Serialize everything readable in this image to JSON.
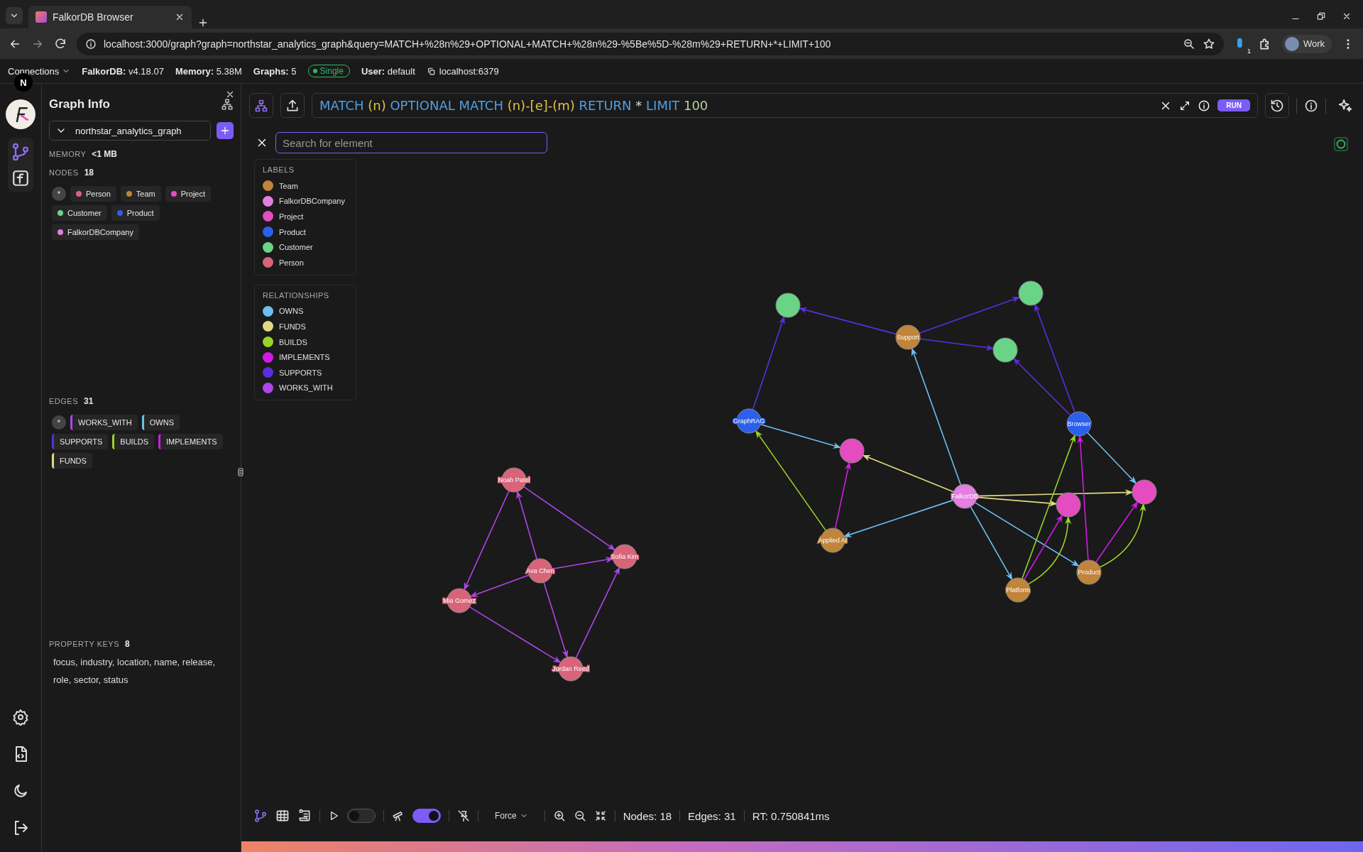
{
  "browser": {
    "tab": {
      "title": "FalkorDB Browser"
    },
    "url": "localhost:3000/graph?graph=northstar_analytics_graph&query=MATCH+%28n%29+OPTIONAL+MATCH+%28n%29-%5Be%5D-%28m%29+RETURN+*+LIMIT+100",
    "profile": "Work",
    "extension_badge": "1"
  },
  "header": {
    "connections": "Connections",
    "stats": [
      {
        "label": "FalkorDB:",
        "value": "v4.18.07"
      },
      {
        "label": "Memory:",
        "value": "5.38M"
      },
      {
        "label": "Graphs:",
        "value": "5"
      }
    ],
    "mode_badge": "Single",
    "user": {
      "label": "User:",
      "value": "default"
    },
    "host": "localhost:6379"
  },
  "rail": {
    "avatar": "N"
  },
  "sidebar": {
    "title": "Graph Info",
    "graph_select": "northstar_analytics_graph",
    "memory": {
      "label": "MEMORY",
      "value": "<1 MB"
    },
    "nodes": {
      "label": "NODES",
      "count": "18",
      "chips": [
        {
          "text": "*",
          "kind": "all"
        },
        {
          "text": "Person",
          "kind": "label",
          "color": "#d8647a"
        },
        {
          "text": "Team",
          "kind": "label",
          "color": "#c0843a"
        },
        {
          "text": "Project",
          "kind": "label",
          "color": "#e44cc0"
        },
        {
          "text": "Customer",
          "kind": "label",
          "color": "#6ad486"
        },
        {
          "text": "Product",
          "kind": "label",
          "color": "#2c5fec"
        },
        {
          "text": "FalkorDBCompany",
          "kind": "label",
          "color": "#e47ee0"
        }
      ]
    },
    "edges": {
      "label": "EDGES",
      "count": "31",
      "chips": [
        {
          "text": "*",
          "kind": "all"
        },
        {
          "text": "WORKS_WITH",
          "kind": "label",
          "color": "#b044e8"
        },
        {
          "text": "OWNS",
          "kind": "label",
          "color": "#6cc0f0"
        },
        {
          "text": "SUPPORTS",
          "kind": "label",
          "color": "#5a2ee0"
        },
        {
          "text": "BUILDS",
          "kind": "label",
          "color": "#98d428"
        },
        {
          "text": "IMPLEMENTS",
          "kind": "label",
          "color": "#d21ae8"
        },
        {
          "text": "FUNDS",
          "kind": "label",
          "color": "#e0d886"
        }
      ]
    },
    "property_keys": {
      "label": "PROPERTY KEYS",
      "count": "8",
      "text": "focus, industry, location, name, release, role, sector, status"
    }
  },
  "query": {
    "tokens": [
      {
        "text": "MATCH",
        "kind": "keyword"
      },
      {
        "text": "(n)",
        "kind": "pattern"
      },
      {
        "text": "OPTIONAL MATCH",
        "kind": "keyword"
      },
      {
        "text": "(n)-[e]-(m)",
        "kind": "pattern"
      },
      {
        "text": "RETURN",
        "kind": "keyword"
      },
      {
        "text": "*",
        "kind": "operator"
      },
      {
        "text": "LIMIT",
        "kind": "keyword"
      },
      {
        "text": "100",
        "kind": "number"
      }
    ],
    "run": "RUN"
  },
  "search": {
    "placeholder": "Search for element"
  },
  "legend": {
    "labels": {
      "title": "LABELS",
      "items": [
        {
          "name": "Team",
          "color": "#c0843a"
        },
        {
          "name": "FalkorDBCompany",
          "color": "#e47ee0"
        },
        {
          "name": "Project",
          "color": "#e44cc0"
        },
        {
          "name": "Product",
          "color": "#2c5fec"
        },
        {
          "name": "Customer",
          "color": "#6ad486"
        },
        {
          "name": "Person",
          "color": "#d8647a"
        }
      ]
    },
    "relationships": {
      "title": "RELATIONSHIPS",
      "items": [
        {
          "name": "OWNS",
          "color": "#6cc0f0"
        },
        {
          "name": "FUNDS",
          "color": "#e0d886"
        },
        {
          "name": "BUILDS",
          "color": "#98d428"
        },
        {
          "name": "IMPLEMENTS",
          "color": "#d21ae8"
        },
        {
          "name": "SUPPORTS",
          "color": "#5a2ee0"
        },
        {
          "name": "WORKS_WITH",
          "color": "#b044e8"
        }
      ]
    }
  },
  "graph": {
    "nodes": [
      {
        "color": "#6ad486"
      },
      {
        "color": "#6ad486"
      },
      {
        "name": "Support",
        "color": "#c0843a"
      },
      {
        "color": "#6ad486"
      },
      {
        "name": "GraphRAG",
        "color": "#2c5fec"
      },
      {
        "name": "Browser",
        "color": "#2c5fec"
      },
      {
        "color": "#e44cc0"
      },
      {
        "name": "FalkorDB",
        "color": "#e47ee0"
      },
      {
        "color": "#e44cc0"
      },
      {
        "color": "#e44cc0"
      },
      {
        "name": "Applied AI",
        "color": "#c0843a"
      },
      {
        "name": "Platform",
        "color": "#c0843a"
      },
      {
        "name": "Product",
        "color": "#c0843a"
      },
      {
        "name": "Noah Patel",
        "color": "#d8647a"
      },
      {
        "name": "Sofia Kim",
        "color": "#d8647a"
      },
      {
        "name": "Ava Chen",
        "color": "#d8647a"
      },
      {
        "name": "Mia Gomez",
        "color": "#d8647a"
      },
      {
        "name": "Jordan Reed",
        "color": "#d8647a"
      }
    ],
    "edges": [
      {
        "color": "#5a2ee0"
      },
      {
        "color": "#5a2ee0"
      },
      {
        "color": "#5a2ee0"
      },
      {
        "color": "#5a2ee0"
      },
      {
        "color": "#5a2ee0"
      },
      {
        "color": "#5a2ee0"
      },
      {
        "color": "#6cc0f0"
      },
      {
        "color": "#6cc0f0"
      },
      {
        "color": "#6cc0f0"
      },
      {
        "color": "#6cc0f0"
      },
      {
        "color": "#6cc0f0"
      },
      {
        "color": "#6cc0f0"
      },
      {
        "color": "#e0d886"
      },
      {
        "color": "#e0d886"
      },
      {
        "color": "#e0d886"
      },
      {
        "color": "#98d428"
      },
      {
        "color": "#98d428"
      },
      {
        "color": "#98d428"
      },
      {
        "color": "#98d428"
      },
      {
        "color": "#d21ae8"
      },
      {
        "color": "#d21ae8"
      },
      {
        "color": "#d21ae8"
      },
      {
        "color": "#d21ae8"
      },
      {
        "color": "#b044e8"
      },
      {
        "color": "#b044e8"
      },
      {
        "color": "#b044e8"
      },
      {
        "color": "#b044e8"
      },
      {
        "color": "#b044e8"
      },
      {
        "color": "#b044e8"
      },
      {
        "color": "#b044e8"
      },
      {
        "color": "#b044e8"
      }
    ]
  },
  "toolbar": {
    "toggles": [
      {
        "on": false
      },
      {
        "on": true
      }
    ],
    "layout": "Force",
    "stats": [
      "Nodes: 18",
      "Edges: 31",
      "RT: 0.750841ms"
    ]
  }
}
